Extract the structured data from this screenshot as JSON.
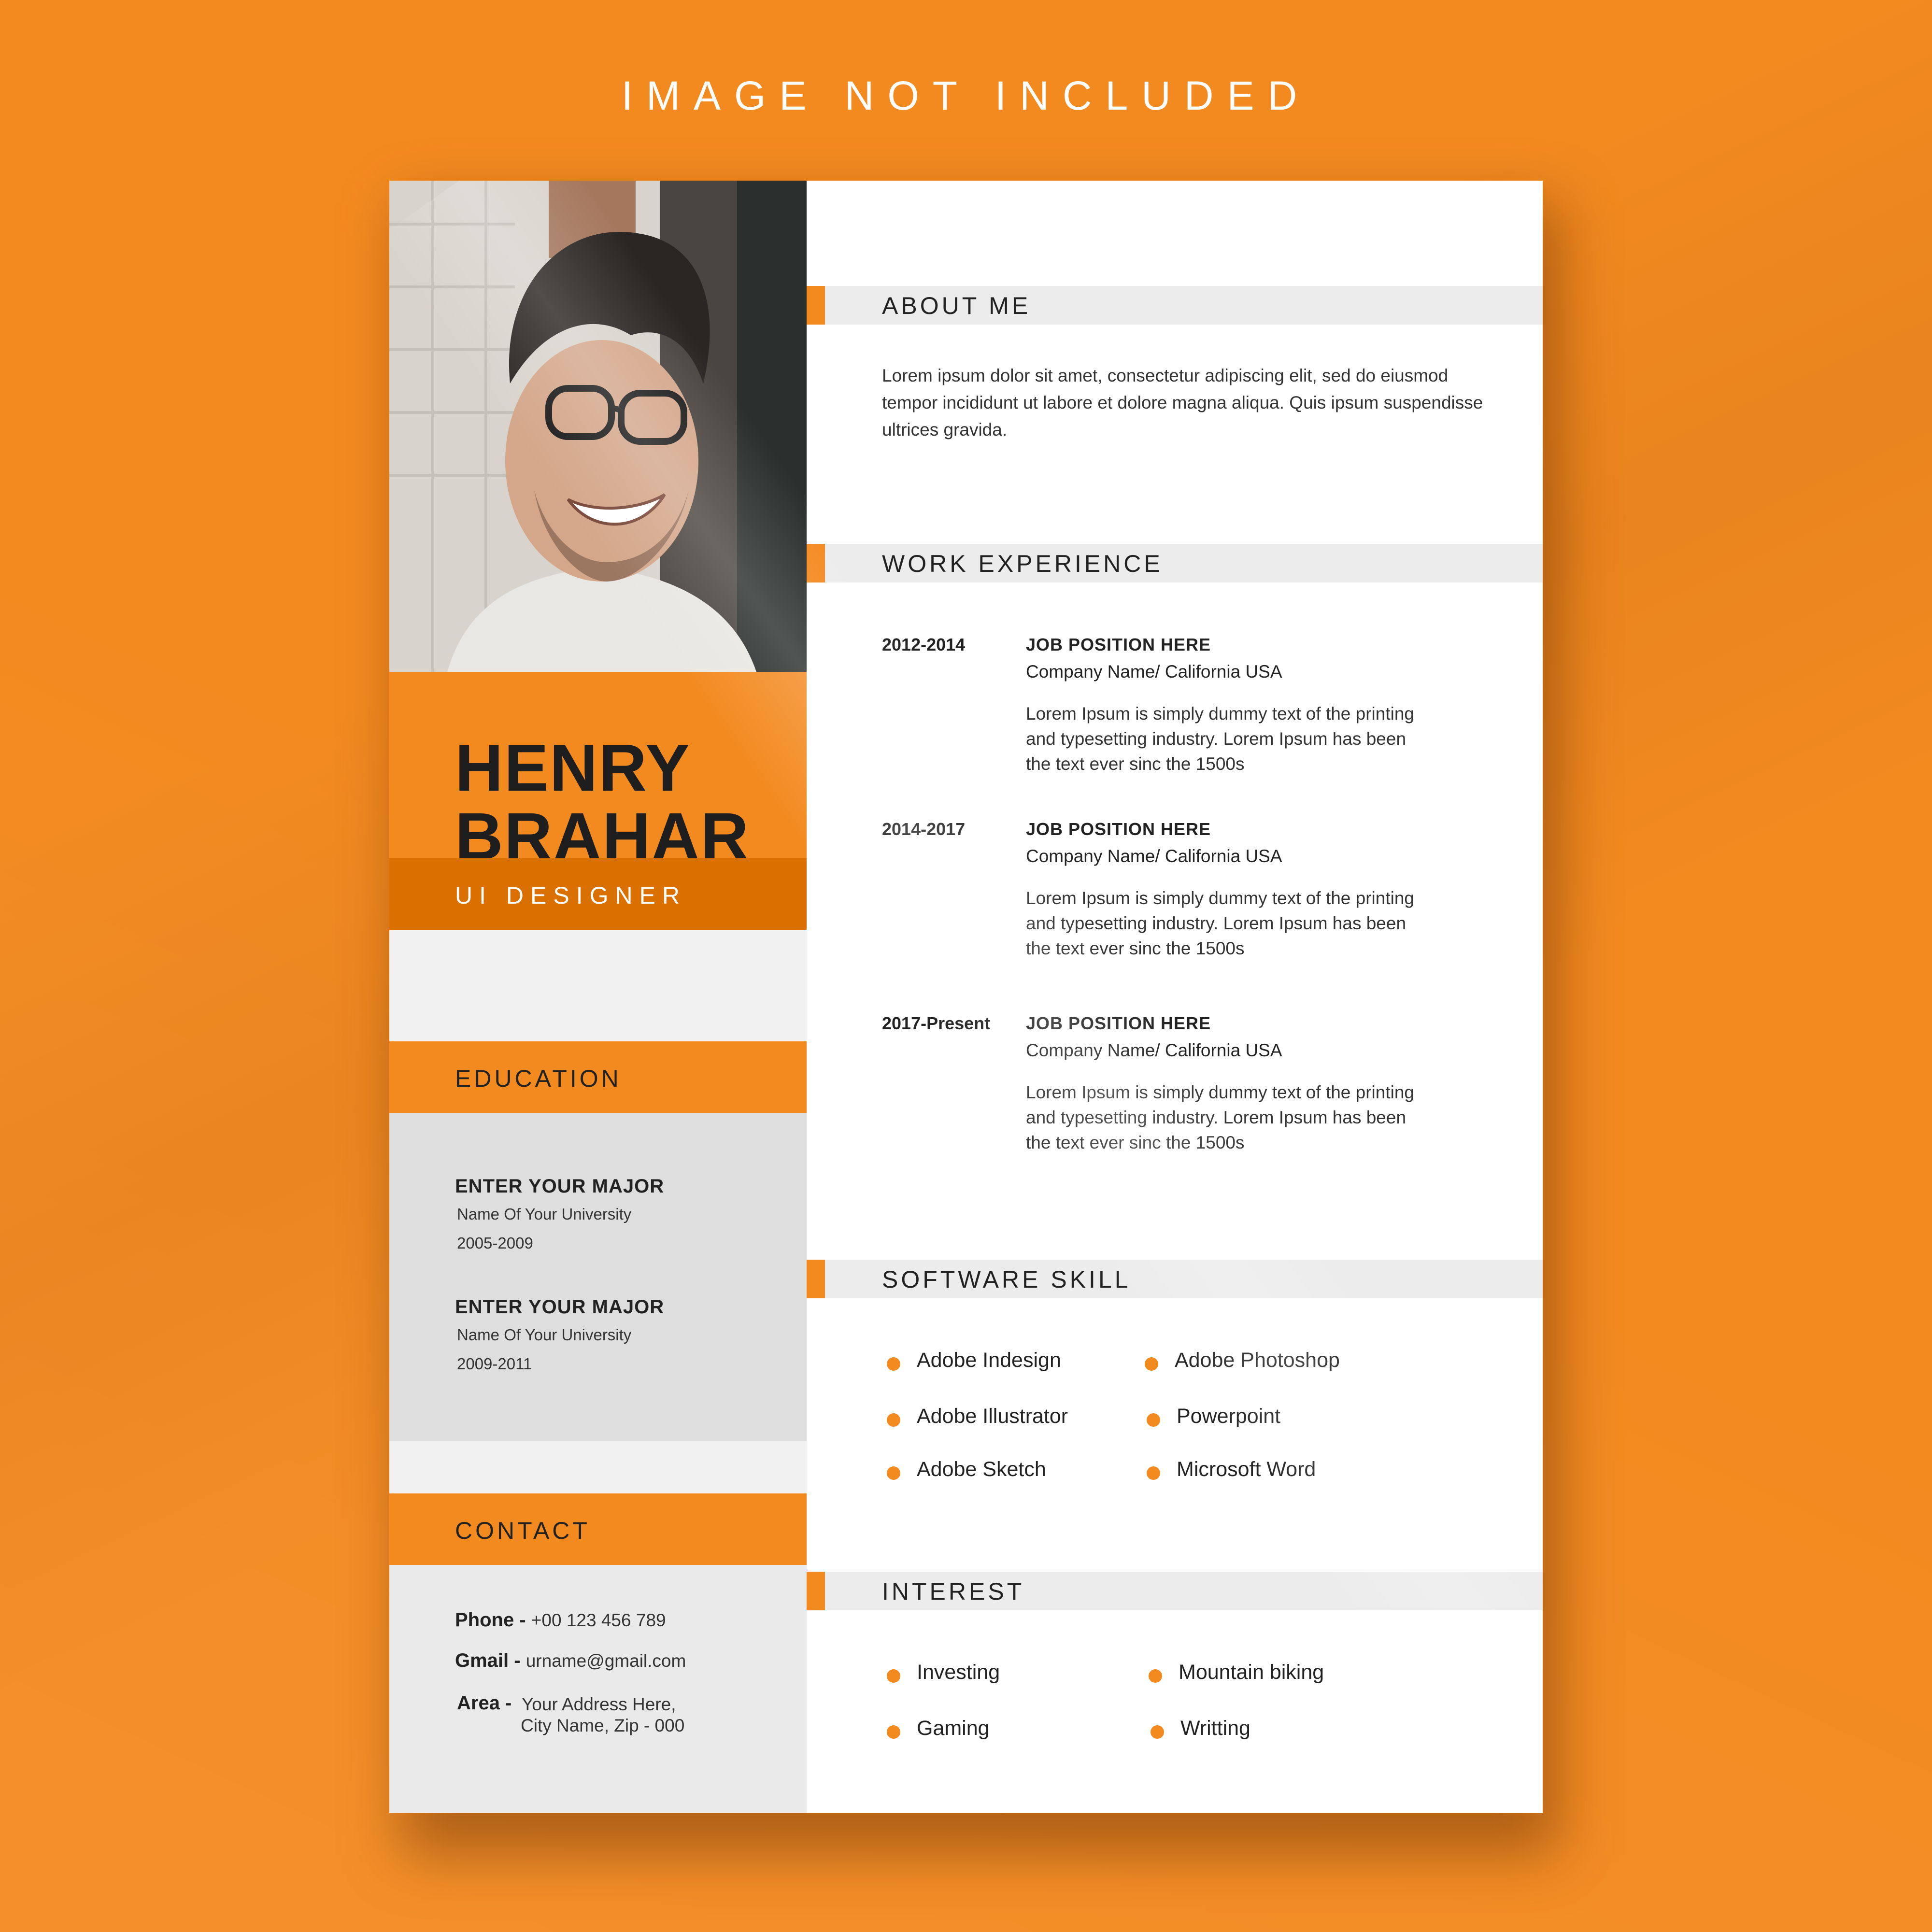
{
  "banner": {
    "text": "IMAGE NOT INCLUDED"
  },
  "colors": {
    "accent": "#f38a20",
    "accent_dark": "#d97000",
    "background": "#f38a20"
  },
  "profile": {
    "first_name": "HENRY",
    "last_name": "BRAHAR",
    "role": "UI DESIGNER"
  },
  "education": {
    "title": "EDUCATION",
    "items": [
      {
        "major": "ENTER YOUR MAJOR",
        "university": "Name Of Your University",
        "years": "2005-2009"
      },
      {
        "major": "ENTER YOUR MAJOR",
        "university": "Name Of Your University",
        "years": "2009-2011"
      }
    ]
  },
  "contact": {
    "title": "CONTACT",
    "phone_label": "Phone -",
    "phone": "+00 123 456 789",
    "gmail_label": "Gmail -",
    "gmail": "urname@gmail.com",
    "area_label": "Area -",
    "area_line1": "Your Address Here,",
    "area_line2": "City Name, Zip - 000"
  },
  "about": {
    "title": "ABOUT ME",
    "text": "Lorem ipsum dolor sit amet, consectetur adipiscing elit, sed do eiusmod tempor incididunt ut labore et dolore magna aliqua. Quis ipsum suspendisse ultrices gravida."
  },
  "work": {
    "title": "WORK EXPERIENCE",
    "jobs": [
      {
        "years": "2012-2014",
        "position": "JOB POSITION HERE",
        "company": "Company Name/ California USA",
        "description": "Lorem Ipsum is simply dummy text of the printing and typesetting industry. Lorem Ipsum has been the text ever sinc the 1500s"
      },
      {
        "years": "2014-2017",
        "position": "JOB POSITION HERE",
        "company": "Company Name/ California USA",
        "description": "Lorem Ipsum is simply dummy text of the printing and typesetting industry. Lorem Ipsum has been the text ever sinc the 1500s"
      },
      {
        "years": "2017-Present",
        "position": "JOB POSITION HERE",
        "company": "Company Name/ California USA",
        "description": "Lorem Ipsum is simply dummy text of the printing and typesetting industry. Lorem Ipsum has been the text ever sinc the 1500s"
      }
    ]
  },
  "skills": {
    "title": "SOFTWARE SKILL",
    "items": [
      "Adobe Indesign",
      "Adobe Photoshop",
      "Adobe Illustrator",
      "Powerpoint",
      "Adobe Sketch",
      "Microsoft Word"
    ]
  },
  "interest": {
    "title": "INTEREST",
    "items": [
      "Investing",
      "Mountain biking",
      "Gaming",
      "Writting"
    ]
  }
}
